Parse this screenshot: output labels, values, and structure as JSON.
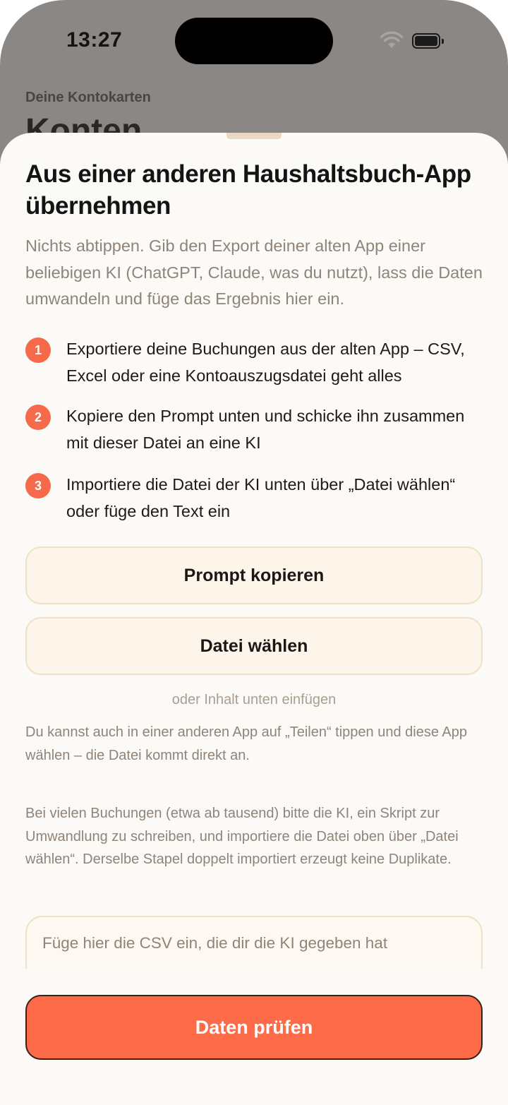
{
  "status_bar": {
    "time": "13:27"
  },
  "background_page": {
    "subtitle": "Deine Kontokarten",
    "title": "Konten"
  },
  "sheet": {
    "title": "Aus einer anderen Haushaltsbuch-App übernehmen",
    "intro": "Nichts abtippen. Gib den Export deiner alten App einer beliebigen KI (ChatGPT, Claude, was du nutzt), lass die Daten umwandeln und füge das Ergebnis hier ein.",
    "steps": [
      {
        "number": "1",
        "text": "Exportiere deine Buchungen aus der alten App – CSV, Excel oder eine Kontoauszugsdatei geht alles"
      },
      {
        "number": "2",
        "text": "Kopiere den Prompt unten und schicke ihn zusammen mit dieser Datei an eine KI"
      },
      {
        "number": "3",
        "text": "Importiere die Datei der KI unten über „Datei wählen“ oder füge den Text ein"
      }
    ],
    "copy_prompt_label": "Prompt kopieren",
    "choose_file_label": "Datei wählen",
    "or_paste_hint": "oder Inhalt unten einfügen",
    "share_note": "Du kannst auch in einer anderen App auf „Teilen“ tippen und diese App wählen – die Datei kommt direkt an.",
    "bulk_note": "Bei vielen Buchungen (etwa ab tausend) bitte die KI, ein Skript zur Umwandlung zu schreiben, und importiere die Datei oben über „Datei wählen“. Derselbe Stapel doppelt importiert erzeugt keine Duplikate.",
    "csv_placeholder": "Füge hier die CSV ein, die dir die KI gegeben hat",
    "check_button_label": "Daten prüfen"
  },
  "colors": {
    "accent": "#fe6b49",
    "step_badge": "#f56a4a",
    "sheet_background": "#fcfaf6",
    "secondary_button_bg": "#fdf5ea"
  }
}
